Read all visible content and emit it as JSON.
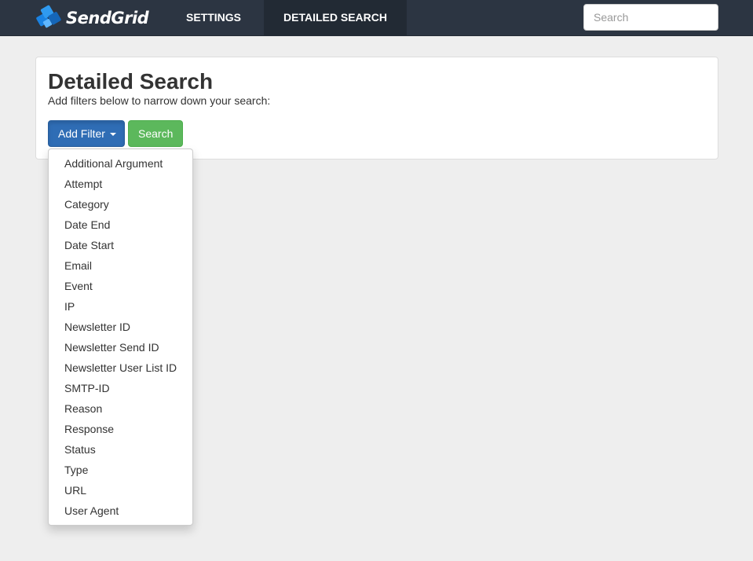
{
  "brand": {
    "name": "SendGrid",
    "logo_icon": "sendgrid-logo-icon",
    "logo_color": "#1a82e2"
  },
  "nav": {
    "items": [
      {
        "label": "SETTINGS",
        "active": false
      },
      {
        "label": "DETAILED SEARCH",
        "active": true
      }
    ],
    "search_placeholder": "Search"
  },
  "page": {
    "title": "Detailed Search",
    "subtitle": "Add filters below to narrow down your search:"
  },
  "buttons": {
    "add_filter_label": "Add Filter",
    "add_filter_icon": "caret-down-icon",
    "search_label": "Search"
  },
  "filter_menu": {
    "open": true,
    "items": [
      "Additional Argument",
      "Attempt",
      "Category",
      "Date End",
      "Date Start",
      "Email",
      "Event",
      "IP",
      "Newsletter ID",
      "Newsletter Send ID",
      "Newsletter User List ID",
      "SMTP-ID",
      "Reason",
      "Response",
      "Status",
      "Type",
      "URL",
      "User Agent"
    ]
  },
  "colors": {
    "navbar_bg": "#2c3542",
    "nav_active_bg": "#222a34",
    "page_bg": "#eeeeee",
    "primary_button": "#2f6db5",
    "success_button": "#5cb85c"
  }
}
